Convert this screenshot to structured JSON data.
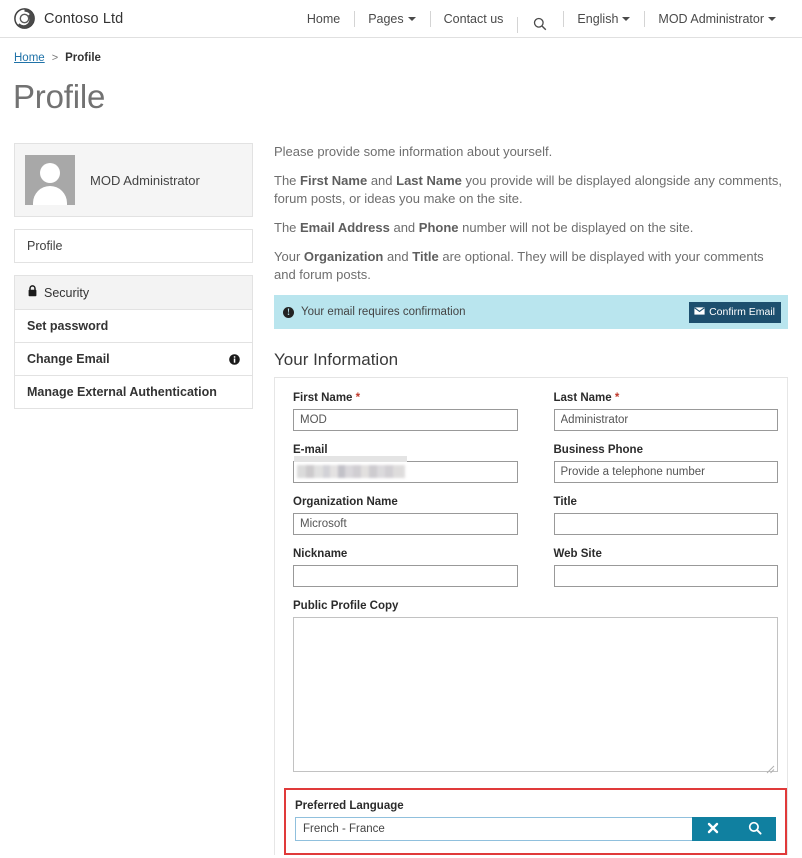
{
  "header": {
    "brand": "Contoso Ltd",
    "logo_icon": "contoso-spiral-logo",
    "nav": [
      {
        "label": "Home",
        "has_caret": false
      },
      {
        "label": "Pages",
        "has_caret": true
      },
      {
        "label": "Contact us",
        "has_caret": false
      },
      {
        "label": "English",
        "has_caret": true
      },
      {
        "label": "MOD Administrator",
        "has_caret": true
      }
    ],
    "search_icon": "search-icon"
  },
  "breadcrumb": {
    "home": "Home",
    "separator": ">",
    "current": "Profile"
  },
  "page_title": "Profile",
  "sidebar": {
    "user_name": "MOD Administrator",
    "avatar_icon": "user-avatar-placeholder",
    "profile_item": "Profile",
    "security_header": "Security",
    "security_icon": "lock-icon",
    "items": [
      {
        "label": "Set password",
        "badge": ""
      },
      {
        "label": "Change Email",
        "badge": "info-icon"
      },
      {
        "label": "Manage External Authentication",
        "badge": ""
      }
    ]
  },
  "intro": {
    "p1": "Please provide some information about yourself.",
    "p2_a": "The ",
    "p2_b1": "First Name",
    "p2_c": " and ",
    "p2_b2": "Last Name",
    "p2_d": " you provide will be displayed alongside any comments, forum posts, or ideas you make on the site.",
    "p3_a": "The ",
    "p3_b1": "Email Address",
    "p3_c": " and ",
    "p3_b2": "Phone",
    "p3_d": " number will not be displayed on the site.",
    "p4_a": "Your ",
    "p4_b1": "Organization",
    "p4_c": " and ",
    "p4_b2": "Title",
    "p4_d": " are optional. They will be displayed with your comments and forum posts."
  },
  "alert": {
    "icon": "info-icon",
    "message": "Your email requires confirmation",
    "button_label": "Confirm Email",
    "button_icon": "envelope-icon",
    "background_color": "#b9e5ee",
    "button_color": "#1d4f6e"
  },
  "section_heading": "Your Information",
  "form": {
    "first_name": {
      "label": "First Name",
      "required": "*",
      "value": "MOD",
      "placeholder": ""
    },
    "last_name": {
      "label": "Last Name",
      "required": "*",
      "value": "Administrator",
      "placeholder": ""
    },
    "email": {
      "label": "E-mail",
      "value": "",
      "placeholder": "",
      "redacted": true
    },
    "business_phone": {
      "label": "Business Phone",
      "value": "",
      "placeholder": "Provide a telephone number"
    },
    "organization_name": {
      "label": "Organization Name",
      "value": "Microsoft",
      "placeholder": ""
    },
    "title": {
      "label": "Title",
      "value": "",
      "placeholder": ""
    },
    "nickname": {
      "label": "Nickname",
      "value": "",
      "placeholder": ""
    },
    "web_site": {
      "label": "Web Site",
      "value": "",
      "placeholder": ""
    },
    "public_profile_copy": {
      "label": "Public Profile Copy",
      "value": "",
      "placeholder": ""
    },
    "preferred_language": {
      "label": "Preferred Language",
      "value": "French - France",
      "placeholder": "",
      "clear_icon": "clear-x-icon",
      "search_icon": "search-icon",
      "highlight_color": "#e03a3a",
      "button_color": "#1080a0"
    }
  }
}
